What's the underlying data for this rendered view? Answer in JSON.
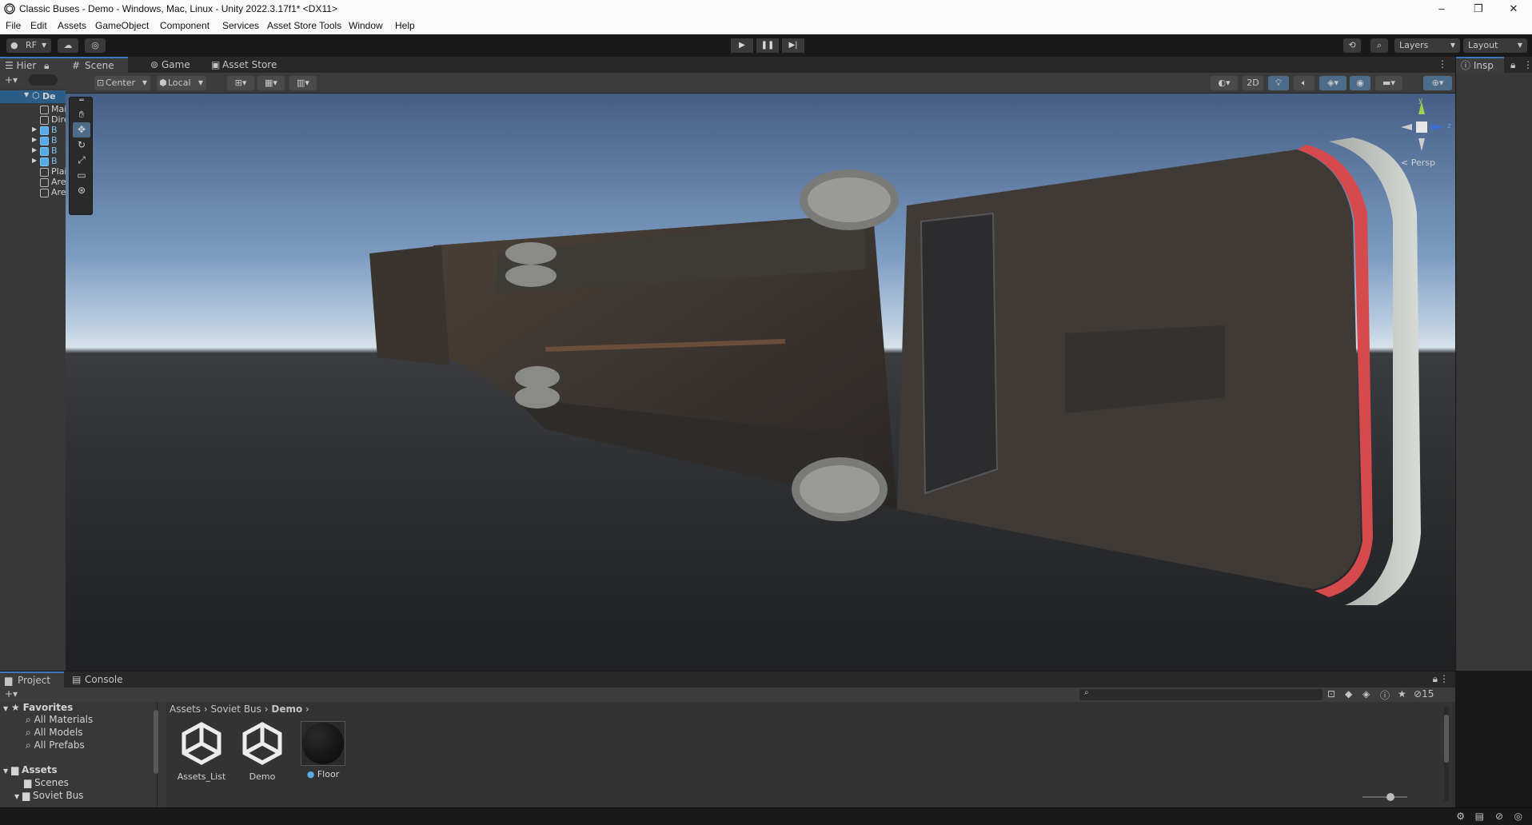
{
  "window": {
    "title": "Classic Buses - Demo - Windows, Mac, Linux - Unity 2022.3.17f1* <DX11>",
    "controls": [
      "–",
      "❐",
      "✕"
    ]
  },
  "menu": [
    "File",
    "Edit",
    "Assets",
    "GameObject",
    "Component",
    "Services",
    "Asset Store Tools",
    "Window",
    "Help"
  ],
  "toolbar": {
    "account": "RF",
    "layers_label": "Layers",
    "layout_label": "Layout"
  },
  "hierarchy": {
    "tab_label": "Hier",
    "root": "De",
    "items": [
      "Mai",
      "Dire",
      "B",
      "B",
      "B",
      "B",
      "Plai",
      "Are",
      "Are"
    ]
  },
  "scene": {
    "tabs": [
      "Scene",
      "Game",
      "Asset Store"
    ],
    "pivot_mode": "Center",
    "pivot_space": "Local",
    "mode_2d": "2D",
    "gizmo_label": "< Persp",
    "gizmo_axes": [
      "y",
      "z"
    ]
  },
  "inspector": {
    "tab_label": "Insp"
  },
  "project": {
    "tabs": [
      "Project",
      "Console"
    ],
    "favorites_label": "Favorites",
    "favorites": [
      "All Materials",
      "All Models",
      "All Prefabs"
    ],
    "assets_label": "Assets",
    "asset_folders": [
      "Scenes",
      "Soviet Bus"
    ],
    "breadcrumb": [
      "Assets",
      "Soviet Bus",
      "Demo"
    ],
    "hidden_count": "15",
    "items": [
      {
        "name": "Assets_List",
        "type": "scene"
      },
      {
        "name": "Demo",
        "type": "scene"
      },
      {
        "name": "Floor",
        "type": "material"
      }
    ]
  },
  "colors": {
    "accent": "#3a79bb",
    "panel": "#383838",
    "dark": "#191919"
  }
}
